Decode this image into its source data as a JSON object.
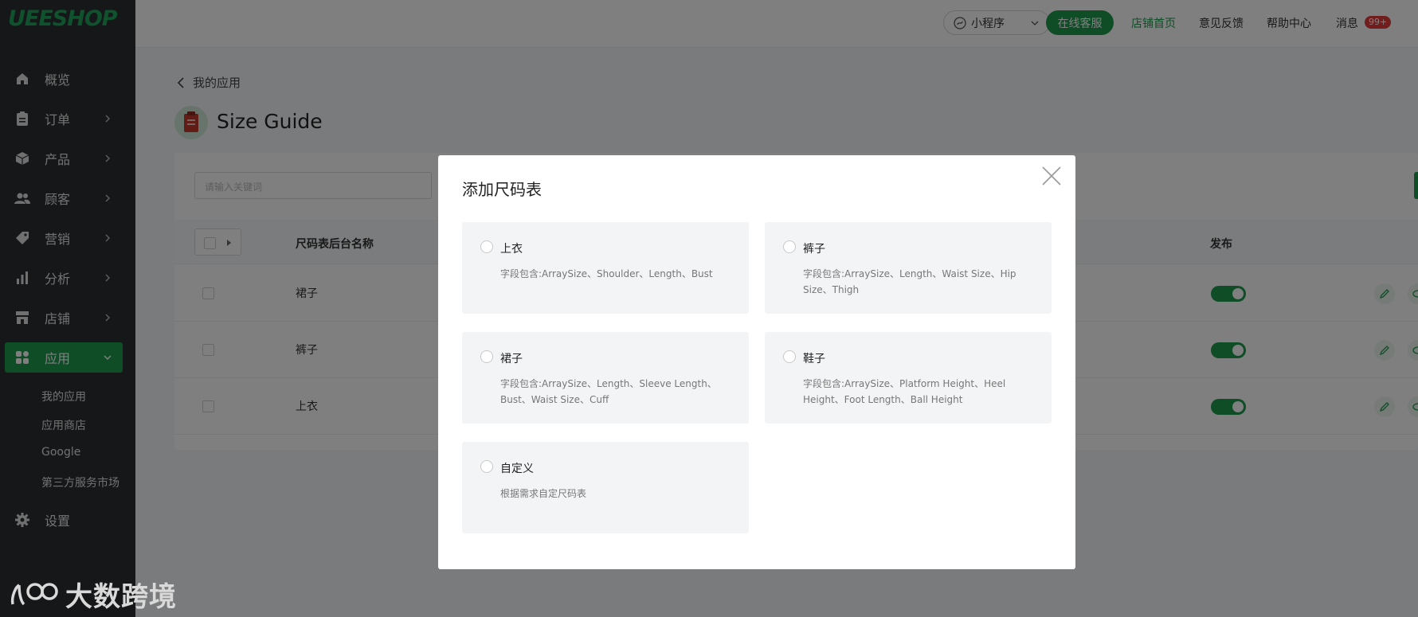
{
  "brand": {
    "logo": "UEESHOP",
    "accent": "#1f9a4f",
    "watermark": "大数跨境"
  },
  "sidebar": {
    "items": [
      {
        "label": "概览",
        "icon": "home-icon"
      },
      {
        "label": "订单",
        "icon": "clipboard-icon"
      },
      {
        "label": "产品",
        "icon": "box-icon"
      },
      {
        "label": "顾客",
        "icon": "users-icon"
      },
      {
        "label": "营销",
        "icon": "tag-icon"
      },
      {
        "label": "分析",
        "icon": "bar-chart-icon"
      },
      {
        "label": "店铺",
        "icon": "store-icon"
      },
      {
        "label": "应用",
        "icon": "apps-icon"
      },
      {
        "label": "设置",
        "icon": "gear-icon"
      }
    ],
    "subitems": [
      "我的应用",
      "应用商店",
      "Google",
      "第三方服务市场"
    ]
  },
  "header": {
    "mini_program": "小程序",
    "online_service": "在线客服",
    "store_home": "店铺首页",
    "feedback": "意见反馈",
    "help": "帮助中心",
    "messages": "消息",
    "messages_badge": "99+"
  },
  "main": {
    "back_label": "我的应用",
    "title": "Size Guide",
    "search_placeholder": "请输入关键词",
    "columns": {
      "name": "尺码表后台名称",
      "publish": "发布"
    },
    "rows": [
      {
        "name": "裙子",
        "published": true
      },
      {
        "name": "裤子",
        "published": true
      },
      {
        "name": "上衣",
        "published": true
      }
    ]
  },
  "modal": {
    "title": "添加尺码表",
    "options": [
      {
        "title": "上衣",
        "desc": "字段包含:ArraySize、Shoulder、Length、Bust"
      },
      {
        "title": "裤子",
        "desc": "字段包含:ArraySize、Length、Waist Size、Hip Size、Thigh"
      },
      {
        "title": "裙子",
        "desc": "字段包含:ArraySize、Length、Sleeve Length、Bust、Waist Size、Cuff"
      },
      {
        "title": "鞋子",
        "desc": "字段包含:ArraySize、Platform Height、Heel Height、Foot Length、Ball Height"
      },
      {
        "title": "自定义",
        "desc": "根据需求自定尺码表"
      }
    ]
  }
}
